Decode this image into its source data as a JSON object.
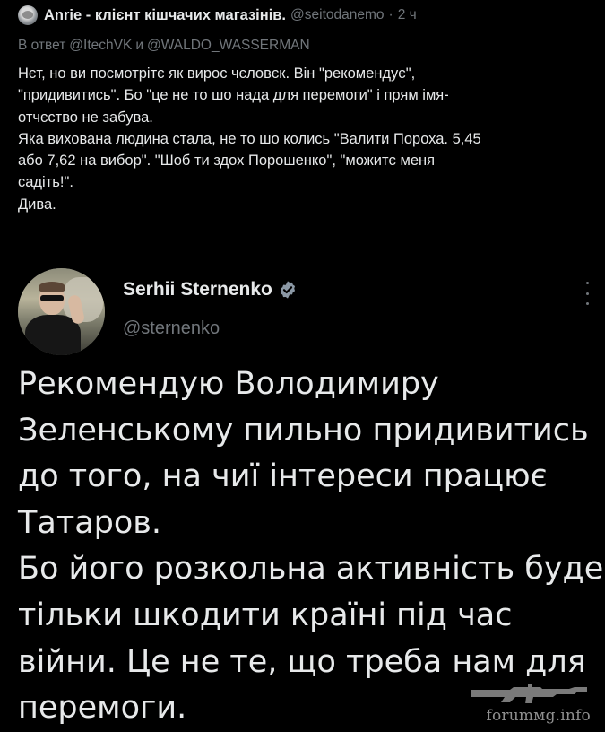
{
  "reply": {
    "author_name": "Anrie - клієнт кішчачих магазінів.",
    "author_handle": "@seitodanemo",
    "separator": "·",
    "time": "2 ч",
    "context_prefix": "В ответ",
    "context_mention_1": "@ItechVK",
    "context_conjunction": "и",
    "context_mention_2": "@WALDO_WASSERMAN",
    "body_lines": [
      "Нєт, но ви посмотрітє як вирос чєловєк. Він \"рекомендує\",",
      "\"придивитись\". Бо \"це не то шо нада для перемоги\" і прям імя-",
      "отчєство не забува.",
      "Яка вихована людина стала, не то шо колись \"Валити Пороха. 5,45",
      "або 7,62 на вибор\". \"Шоб ти здох Порошенко\", \"можитє меня",
      "садіть!\".",
      "Дива."
    ]
  },
  "tweet": {
    "author_name": "Serhii Sternenko",
    "author_handle": "@sternenko",
    "verified": true,
    "body_lines": [
      "Рекомендую Володимиру",
      "Зеленському пильно придивитись",
      "до того, на чиї інтереси працює",
      "Татаров.",
      "Бо його розкольна активність буде",
      "тільки шкодити країні під час",
      "війни. Це не те, що треба нам для",
      "перемоги."
    ]
  },
  "watermark": {
    "text": "forumмg.info"
  },
  "colors": {
    "background": "#000000",
    "text_primary": "#e7e9ea",
    "text_secondary": "#71767b",
    "verified_badge": "#8b98a5"
  },
  "icons": {
    "more": "more-vertical-icon",
    "verified": "verified-badge-icon"
  }
}
